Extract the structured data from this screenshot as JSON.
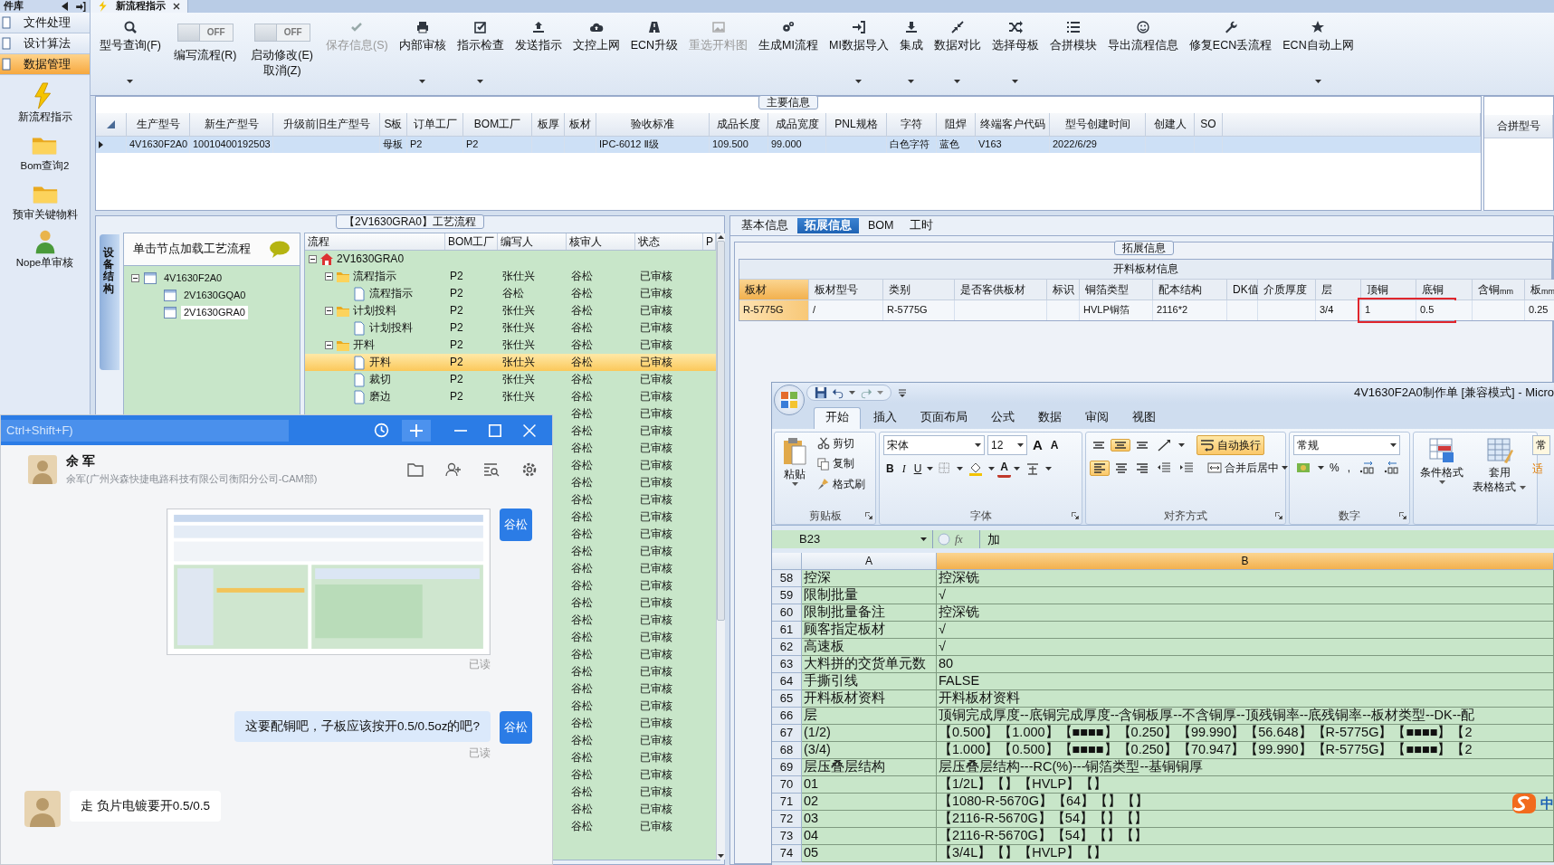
{
  "app_tabs": {
    "panel_title": "件库",
    "document_tab": "新流程指示"
  },
  "sidebar": {
    "items": [
      {
        "label": "文件处理",
        "selected": false
      },
      {
        "label": "设计算法",
        "selected": false
      },
      {
        "label": "数据管理",
        "selected": true
      }
    ],
    "shortcuts": [
      {
        "label": "新流程指示",
        "kind": "bolt"
      },
      {
        "label": "Bom查询2",
        "kind": "folder"
      },
      {
        "label": "预审关键物料",
        "kind": "folder"
      },
      {
        "label": "Nope单审核",
        "kind": "person"
      }
    ]
  },
  "toolbar": [
    {
      "kind": "button",
      "label": "型号查询(F)",
      "disabled": false,
      "dropdown": true
    },
    {
      "kind": "toggle",
      "label": "编写流程(R)",
      "switch_text": "OFF",
      "on": false
    },
    {
      "kind": "toggle",
      "label": "启动修改(E)",
      "second_label": "取消(Z)",
      "switch_text": "OFF",
      "on": false
    },
    {
      "kind": "button",
      "label": "保存信息(S)",
      "disabled": true,
      "dropdown": false
    },
    {
      "kind": "button",
      "label": "内部审核",
      "disabled": false,
      "dropdown": true
    },
    {
      "kind": "button",
      "label": "指示检查",
      "disabled": false,
      "dropdown": true
    },
    {
      "kind": "button",
      "label": "发送指示",
      "disabled": false,
      "dropdown": false
    },
    {
      "kind": "button",
      "label": "文控上网",
      "disabled": false,
      "dropdown": false
    },
    {
      "kind": "button",
      "label": "ECN升级",
      "disabled": false,
      "dropdown": false
    },
    {
      "kind": "button",
      "label": "重选开料图",
      "disabled": true,
      "dropdown": false
    },
    {
      "kind": "button",
      "label": "生成MI流程",
      "disabled": false,
      "dropdown": false
    },
    {
      "kind": "button",
      "label": "MI数据导入",
      "disabled": false,
      "dropdown": true
    },
    {
      "kind": "button",
      "label": "集成",
      "disabled": false,
      "dropdown": true
    },
    {
      "kind": "button",
      "label": "数据对比",
      "disabled": false,
      "dropdown": true
    },
    {
      "kind": "button",
      "label": "选择母板",
      "disabled": false,
      "dropdown": true
    },
    {
      "kind": "button",
      "label": "合拼模块",
      "disabled": false,
      "dropdown": false
    },
    {
      "kind": "button",
      "label": "导出流程信息",
      "disabled": false,
      "dropdown": false
    },
    {
      "kind": "button",
      "label": "修复ECN丢流程",
      "disabled": false,
      "dropdown": false
    },
    {
      "kind": "button",
      "label": "ECN自动上网",
      "disabled": false,
      "dropdown": true
    }
  ],
  "main_info": {
    "title": "主要信息",
    "columns": [
      "生产型号",
      "新生产型号",
      "升级前旧生产型号",
      "S板",
      "订单工厂",
      "BOM工厂",
      "板厚",
      "板材",
      "验收标准",
      "成品长度",
      "成品宽度",
      "PNL规格",
      "字符",
      "阻焊",
      "终端客户代码",
      "型号创建时间",
      "创建人",
      "SO"
    ],
    "rows": [
      {
        "selected": true,
        "cells": [
          "4V1630F2A0",
          "10010400192503",
          null,
          "母板",
          "P2",
          "P2",
          null,
          null,
          "IPC-6012 Ⅱ级",
          "109.500",
          "99.000",
          null,
          "白色字符",
          "蓝色",
          "V163",
          "2022/6/29",
          null,
          null
        ]
      }
    ],
    "side_column": "合拼型号"
  },
  "process": {
    "title": "【2V1630GRA0】工艺流程",
    "side_tab": "设备结构",
    "hint": "单击节点加载工艺流程",
    "model_tree": [
      {
        "label": "4V1630F2A0",
        "selected": false,
        "expanded": true,
        "children": [
          {
            "label": "2V1630GQA0",
            "selected": false
          },
          {
            "label": "2V1630GRA0",
            "selected": true
          }
        ]
      }
    ],
    "grid": {
      "columns": [
        "流程",
        "BOM工厂",
        "编写人",
        "核审人",
        "状态",
        "P"
      ],
      "tree": [
        {
          "kind": "home",
          "label": "2V1630GRA0",
          "expanded": true,
          "selected": false,
          "children": [
            {
              "kind": "folder",
              "label": "流程指示",
              "factory": "P2",
              "author": "张仕兴",
              "reviewer": "谷松",
              "status": "已审核",
              "expanded": true,
              "selected": false,
              "children": [
                {
                  "kind": "doc",
                  "label": "流程指示",
                  "factory": "P2",
                  "author": "谷松",
                  "reviewer": "谷松",
                  "status": "已审核",
                  "selected": false
                }
              ]
            },
            {
              "kind": "folder",
              "label": "计划投料",
              "factory": "P2",
              "author": "张仕兴",
              "reviewer": "谷松",
              "status": "已审核",
              "expanded": true,
              "selected": false,
              "children": [
                {
                  "kind": "doc",
                  "label": "计划投料",
                  "factory": "P2",
                  "author": "张仕兴",
                  "reviewer": "谷松",
                  "status": "已审核",
                  "selected": false
                }
              ]
            },
            {
              "kind": "folder",
              "label": "开料",
              "factory": "P2",
              "author": "张仕兴",
              "reviewer": "谷松",
              "status": "已审核",
              "expanded": true,
              "selected": false,
              "children": [
                {
                  "kind": "doc",
                  "label": "开料",
                  "factory": "P2",
                  "author": "张仕兴",
                  "reviewer": "谷松",
                  "status": "已审核",
                  "selected": true
                },
                {
                  "kind": "doc",
                  "label": "裁切",
                  "factory": "P2",
                  "author": "张仕兴",
                  "reviewer": "谷松",
                  "status": "已审核",
                  "selected": false
                },
                {
                  "kind": "doc",
                  "label": "磨边",
                  "factory": "P2",
                  "author": "张仕兴",
                  "reviewer": "谷松",
                  "status": "已审核",
                  "selected": false
                }
              ]
            }
          ]
        }
      ],
      "covered_rows": [
        {
          "reviewer": "谷松",
          "status": "已审核"
        },
        {
          "reviewer": "谷松",
          "status": "已审核"
        },
        {
          "reviewer": "谷松",
          "status": "已审核"
        },
        {
          "reviewer": "谷松",
          "status": "已审核"
        },
        {
          "reviewer": "谷松",
          "status": "已审核"
        },
        {
          "reviewer": "谷松",
          "status": "已审核"
        },
        {
          "reviewer": "谷松",
          "status": "已审核"
        },
        {
          "reviewer": "谷松",
          "status": "已审核"
        },
        {
          "reviewer": "谷松",
          "status": "已审核"
        },
        {
          "reviewer": "谷松",
          "status": "已审核"
        },
        {
          "reviewer": "谷松",
          "status": "已审核"
        },
        {
          "reviewer": "谷松",
          "status": "已审核"
        },
        {
          "reviewer": "谷松",
          "status": "已审核"
        },
        {
          "reviewer": "谷松",
          "status": "已审核"
        },
        {
          "reviewer": "谷松",
          "status": "已审核"
        },
        {
          "reviewer": "谷松",
          "status": "已审核"
        },
        {
          "reviewer": "谷松",
          "status": "已审核"
        },
        {
          "reviewer": "谷松",
          "status": "已审核"
        },
        {
          "reviewer": "谷松",
          "status": "已审核"
        },
        {
          "reviewer": "谷松",
          "status": "已审核"
        },
        {
          "reviewer": "谷松",
          "status": "已审核"
        },
        {
          "reviewer": "谷松",
          "status": "已审核"
        },
        {
          "reviewer": "谷松",
          "status": "已审核"
        },
        {
          "reviewer": "谷松",
          "status": "已审核"
        },
        {
          "reviewer": "谷松",
          "status": "已审核"
        }
      ]
    }
  },
  "detail": {
    "tabs": [
      {
        "label": "基本信息",
        "selected": false
      },
      {
        "label": "拓展信息",
        "selected": true
      },
      {
        "label": "BOM",
        "selected": false
      },
      {
        "label": "工时",
        "selected": false
      }
    ],
    "group_title": "拓展信息",
    "table_title": "开料板材信息",
    "columns": [
      {
        "label": "板材",
        "framed": false,
        "value": "R-5775G"
      },
      {
        "label": "板材型号",
        "framed": false,
        "value": "/"
      },
      {
        "label": "类别",
        "framed": false,
        "value": "R-5775G"
      },
      {
        "label": "是否客供板材",
        "framed": false
      },
      {
        "label": "标识",
        "framed": false
      },
      {
        "label": "铜箔类型",
        "framed": false,
        "value": "HVLP铜箔"
      },
      {
        "label": "配本结构",
        "framed": false,
        "value": "2116*2"
      },
      {
        "label": "DK值",
        "framed": false
      },
      {
        "label": "介质厚度",
        "framed": false
      },
      {
        "label": "层",
        "framed": false,
        "value": "3/4"
      },
      {
        "label": "顶铜",
        "framed": true,
        "value": "1"
      },
      {
        "label": "底铜",
        "framed": true,
        "value": "0.5"
      },
      {
        "label": "含铜$_{mm}$",
        "framed": false
      },
      {
        "label": "板$_{mm}$",
        "framed": false,
        "value": "0.25"
      }
    ]
  },
  "excel": {
    "title": "4V1630F2A0制作单  [兼容模式] - Micro",
    "tabs": [
      {
        "label": "开始",
        "selected": true
      },
      {
        "label": "插入",
        "selected": false
      },
      {
        "label": "页面布局",
        "selected": false
      },
      {
        "label": "公式",
        "selected": false
      },
      {
        "label": "数据",
        "selected": false
      },
      {
        "label": "审阅",
        "selected": false
      },
      {
        "label": "视图",
        "selected": false
      }
    ],
    "clipboard": {
      "group": "剪贴板",
      "paste": "粘贴",
      "cut": "剪切",
      "copy": "复制",
      "format_painter": "格式刷"
    },
    "font": {
      "group": "字体",
      "name": "宋体",
      "size": "12",
      "grow": "A",
      "shrink": "A",
      "bold": "B",
      "italic": "I",
      "underline": "U",
      "color_button": "A"
    },
    "alignment": {
      "group": "对齐方式",
      "wrap": "自动换行",
      "wrap_on": true,
      "merge": "合并后居中",
      "vertical": [
        {
          "selected": false
        },
        {
          "selected": true
        },
        {
          "selected": false
        }
      ],
      "horizontal": [
        {
          "selected": true
        },
        {
          "selected": false
        },
        {
          "selected": false
        }
      ]
    },
    "number": {
      "group": "数字",
      "format": "常规",
      "percent": "%",
      "comma": ","
    },
    "styles": {
      "conditional": "条件格式",
      "table_format": [
        "套用",
        "表格格式"
      ],
      "cell_style": "常",
      "cell_style_2": "适"
    },
    "name_box": "B23",
    "fx": "fx",
    "formula": "加",
    "columns": [
      {
        "label": "A",
        "selected": false
      },
      {
        "label": "B",
        "selected": true
      }
    ],
    "rows": [
      {
        "row": "58",
        "a": "控深",
        "b": "控深铣"
      },
      {
        "row": "59",
        "a": "限制批量",
        "b": "√"
      },
      {
        "row": "60",
        "a": "限制批量备注",
        "b": "控深铣"
      },
      {
        "row": "61",
        "a": "顾客指定板材",
        "b": "√"
      },
      {
        "row": "62",
        "a": "高速板",
        "b": "√"
      },
      {
        "row": "63",
        "a": "大料拼的交货单元数",
        "b": "80"
      },
      {
        "row": "64",
        "a": "手撕引线",
        "b": "FALSE"
      },
      {
        "row": "65",
        "a": "开料板材资料",
        "b": "开料板材资料"
      },
      {
        "row": "66",
        "a": "层",
        "b": "顶铜完成厚度--底铜完成厚度--含铜板厚--不含铜厚--顶残铜率--底残铜率--板材类型--DK--配"
      },
      {
        "row": "67",
        "a": "(1/2)",
        "b": "【0.500】【1.000】【■■■■】【0.250】【99.990】【56.648】【R-5775G】【■■■■】【2"
      },
      {
        "row": "68",
        "a": "(3/4)",
        "b": "【1.000】【0.500】【■■■■】【0.250】【70.947】【99.990】【R-5775G】【■■■■】【2"
      },
      {
        "row": "69",
        "a": "层压叠层结构",
        "b": "层压叠层结构---RC(%)---铜箔类型--基铜铜厚"
      },
      {
        "row": "70",
        "a": "01",
        "b": "【1/2L】【】【HVLP】【】"
      },
      {
        "row": "71",
        "a": "02",
        "b": "【1080-R-5670G】【64】【】【】"
      },
      {
        "row": "72",
        "a": "03",
        "b": "【2116-R-5670G】【54】【】【】"
      },
      {
        "row": "73",
        "a": "04",
        "b": "【2116-R-5670G】【54】【】【】"
      },
      {
        "row": "74",
        "a": "05",
        "b": "【3/4L】【】【HVLP】【】"
      }
    ],
    "ime_mode": "中"
  },
  "chat": {
    "search": {
      "placeholder": "Ctrl+Shift+F)"
    },
    "contact": {
      "name": "余 军",
      "detail": "余军(广州兴森快捷电路科技有限公司衡阳分公司-CAM部)"
    },
    "messages": [
      {
        "kind": "image",
        "outgoing": true,
        "sender": "谷松",
        "receipt": "已读"
      },
      {
        "kind": "text",
        "outgoing": true,
        "sender": "谷松",
        "text": "这要配铜吧，子板应该按开0.5/0.5oz的吧?",
        "receipt": "已读"
      },
      {
        "kind": "text",
        "outgoing": false,
        "text": "走 负片电镀要开0.5/0.5"
      }
    ]
  }
}
